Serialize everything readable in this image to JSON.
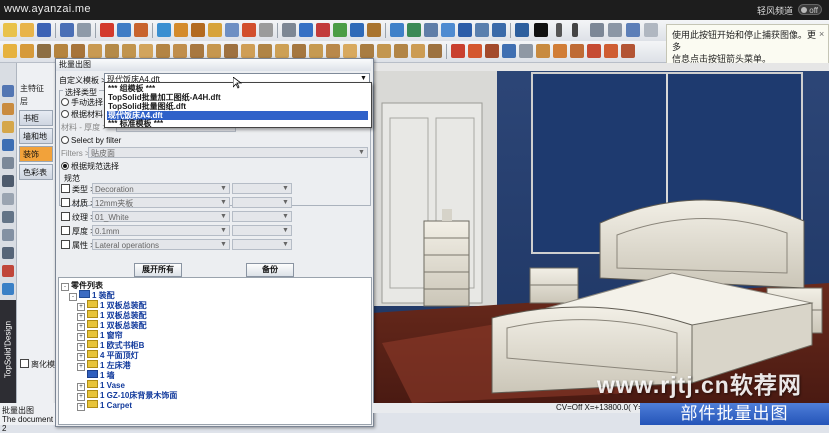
{
  "browser": {
    "url": "www.ayanzai.me",
    "channel_label": "轻风频道",
    "toggle_label": "off"
  },
  "tip": {
    "line1": "使用此按钮开始和停止捕获图像。更多",
    "line2": "信息点击按钮箭头菜单。",
    "close": "×"
  },
  "side_panel": {
    "tab1": "主特征",
    "tab2": "层",
    "buttons": [
      "书柜",
      "墙和地",
      "装饰",
      "色彩表"
    ],
    "bottom_check": "离化模",
    "bottom_text1": "批量出图",
    "bottom_text2": "The document 2"
  },
  "brand": {
    "text": "TopSolid'Design"
  },
  "dialog": {
    "title": "批量出图",
    "template_label": "自定义模板 >",
    "template_value": "现代饭床A4.dft",
    "select_type_label": "选择类型",
    "manual_select": "手动选择",
    "by_material": "根据材料",
    "material_thickness_label": "材料 - 厚度 >",
    "select_by_filter": "Select by filter",
    "filters_label": "Filters >",
    "filters_value": "贴皮面",
    "by_spec": "根据规范选择",
    "spec_header": "规范",
    "spec_rows": [
      {
        "label": "类型",
        "value": "Decoration"
      },
      {
        "label": "材质",
        "value": "12mm夹板"
      },
      {
        "label": "纹理",
        "value": "01_White"
      },
      {
        "label": "厚度",
        "value": "0.1mm"
      },
      {
        "label": "属性",
        "value": "Lateral operations"
      }
    ],
    "expand_all": "展开所有",
    "backup": "备份"
  },
  "dropdown": {
    "items": [
      "*** 组模板 ***",
      "TopSolid批量加工图纸-A4H.dft",
      "TopSolid批量图纸.dft",
      "现代饭床A4.dft",
      "*** 标准模板 ***"
    ],
    "selected_index": 3
  },
  "tree": {
    "header": "零件列表",
    "nodes": [
      {
        "label": "1 装配",
        "level": 0,
        "icon": "assembly"
      },
      {
        "label": "1 双板总装配",
        "level": 1,
        "icon": "folder"
      },
      {
        "label": "1 双板总装配",
        "level": 1,
        "icon": "folder"
      },
      {
        "label": "1 双板总装配",
        "level": 1,
        "icon": "folder"
      },
      {
        "label": "1 窗帘",
        "level": 1,
        "icon": "folder"
      },
      {
        "label": "1 欧式书柜B",
        "level": 1,
        "icon": "folder"
      },
      {
        "label": "4 平面顶灯",
        "level": 1,
        "icon": "folder"
      },
      {
        "label": "1 左床港",
        "level": 1,
        "icon": "folder"
      },
      {
        "label": "1 墙",
        "level": 1,
        "icon": "wall"
      },
      {
        "label": "1 Vase",
        "level": 1,
        "icon": "folder"
      },
      {
        "label": "1 GZ-10床背景木饰面",
        "level": 1,
        "icon": "folder"
      },
      {
        "label": "1 Carpet",
        "level": 1,
        "icon": "folder"
      }
    ]
  },
  "status": {
    "text": "CV=Off  X=+13800.0( Y=-"
  },
  "watermark": {
    "site": "www.rjtj.cn软荐网",
    "banner": "部件批量出图"
  },
  "colors": {
    "viewport_bg": "#223a6c",
    "selection": "#2f61c9",
    "accent_orange": "#f2a23a"
  }
}
